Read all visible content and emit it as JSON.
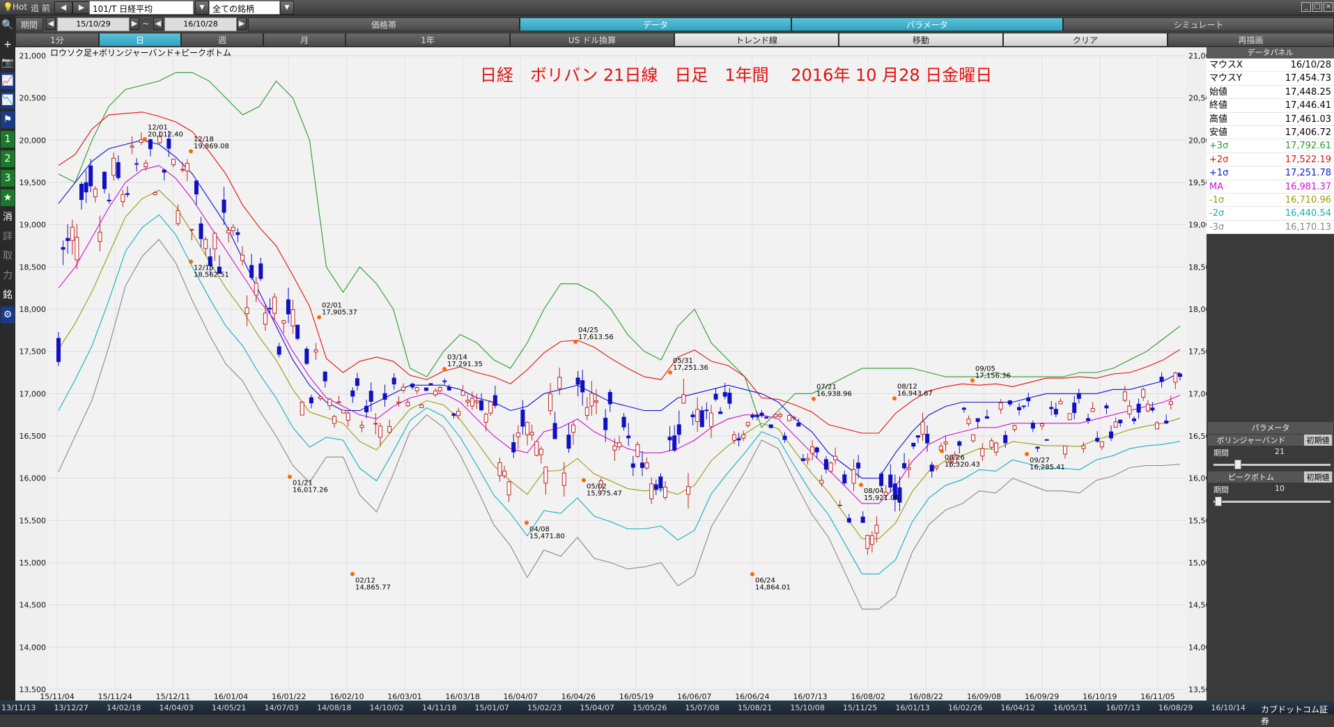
{
  "toolbar": {
    "hot": "Hot",
    "tsui": "追",
    "zen": "前",
    "symbol": "101/T 日経平均",
    "universe": "全ての銘柄",
    "period_label": "期間",
    "date_from": "15/10/29",
    "date_tilde": "~",
    "date_to": "16/10/28",
    "tabs_row1": [
      "価格帯",
      "データ",
      "パラメータ",
      "シミュレート"
    ],
    "tabs_row2": [
      "1分",
      "日",
      "週",
      "月",
      "1年",
      "US ドル換算",
      "トレンド線",
      "移動",
      "クリア",
      "再描画"
    ]
  },
  "left_tools": [
    "🔍",
    "+",
    "📷",
    "📈",
    "📉",
    "⚑",
    "1",
    "2",
    "3",
    "★",
    "消",
    "詳",
    "取",
    "力",
    "銘",
    "⚙"
  ],
  "chart_data": {
    "type": "candlestick",
    "label_topleft": "ロウソク足+ボリンジャーバンド+ピークボトム",
    "title": "日経　ボリバン 21日線　日足　1年間　 2016年 10 月28  日金曜日",
    "ylim": [
      13500,
      21000
    ],
    "yticks": [
      "21,000",
      "20,500",
      "20,000",
      "19,500",
      "19,000",
      "18,500",
      "18,000",
      "17,500",
      "17,000",
      "16,500",
      "16,000",
      "15,500",
      "15,000",
      "14,500",
      "14,000",
      "13,500"
    ],
    "xticks": [
      "15/11/04",
      "15/11/24",
      "15/12/11",
      "16/01/04",
      "16/01/22",
      "16/02/10",
      "16/03/01",
      "16/03/18",
      "16/04/07",
      "16/04/26",
      "16/05/19",
      "16/06/07",
      "16/06/24",
      "16/07/13",
      "16/08/02",
      "16/08/22",
      "16/09/08",
      "16/09/29",
      "16/10/19",
      "16/11/05"
    ],
    "peaks": [
      {
        "date": "12/01",
        "value": "20,012.40"
      },
      {
        "date": "12/18",
        "value": "19,869.08"
      },
      {
        "date": "12/15",
        "value": "18,562.51"
      },
      {
        "date": "02/01",
        "value": "17,905.37"
      },
      {
        "date": "01/21",
        "value": "16,017.26"
      },
      {
        "date": "02/12",
        "value": "14,865.77"
      },
      {
        "date": "03/14",
        "value": "17,291.35"
      },
      {
        "date": "04/08",
        "value": "15,471.80"
      },
      {
        "date": "04/25",
        "value": "17,613.56"
      },
      {
        "date": "05/02",
        "value": "15,975.47"
      },
      {
        "date": "05/31",
        "value": "17,251.36"
      },
      {
        "date": "06/24",
        "value": "14,864.01"
      },
      {
        "date": "07/21",
        "value": "16,938.96"
      },
      {
        "date": "08/04",
        "value": "15,921.04"
      },
      {
        "date": "08/12",
        "value": "16,943.67"
      },
      {
        "date": "08/26",
        "value": "16,320.43"
      },
      {
        "date": "09/05",
        "value": "17,156.36"
      },
      {
        "date": "09/27",
        "value": "16,285.41"
      }
    ],
    "ma_points": [
      18250,
      18500,
      18850,
      19200,
      19500,
      19650,
      19700,
      19550,
      19300,
      19000,
      18700,
      18400,
      18100,
      17850,
      17500,
      17200,
      16950,
      16850,
      16750,
      16700,
      16850,
      16950,
      17000,
      17000,
      16900,
      16700,
      16500,
      16350,
      16300,
      16550,
      16600,
      16700,
      16550,
      16450,
      16350,
      16300,
      16300,
      16350,
      16450,
      16600,
      16700,
      16750,
      16750,
      16700,
      16500,
      16300,
      16100,
      15900,
      15700,
      15700,
      15900,
      16200,
      16400,
      16500,
      16550,
      16600,
      16600,
      16650,
      16650,
      16650,
      16650,
      16650,
      16700,
      16750,
      16800,
      16850,
      16900,
      16980
    ],
    "sigma1_up": [
      19250,
      19500,
      19750,
      19900,
      19950,
      20000,
      19950,
      19800,
      19600,
      19300,
      19000,
      18600,
      18200,
      17800,
      17400,
      17100,
      16900,
      16800,
      16800,
      16900,
      17000,
      17100,
      17100,
      17100,
      17050,
      16950,
      16900,
      16800,
      16850,
      17000,
      17050,
      17100,
      17000,
      16900,
      16850,
      16800,
      16800,
      16950,
      17000,
      17050,
      17100,
      17050,
      17000,
      16900,
      16700,
      16550,
      16300,
      16150,
      16000,
      16000,
      16300,
      16550,
      16750,
      16850,
      16900,
      16900,
      16900,
      16900,
      16950,
      17000,
      17000,
      17000,
      17000,
      17050,
      17050,
      17100,
      17150,
      17250
    ],
    "sigma3_up": [
      19600,
      19500,
      20000,
      20400,
      20600,
      20650,
      20700,
      20800,
      20800,
      20700,
      20500,
      20300,
      20400,
      20700,
      20500,
      20000,
      18500,
      18200,
      18500,
      18300,
      18000,
      17300,
      17200,
      17500,
      17700,
      17600,
      17400,
      17300,
      17600,
      18000,
      18300,
      18300,
      18200,
      18000,
      17700,
      17500,
      17400,
      17800,
      18000,
      17600,
      17400,
      17200,
      16600,
      16800,
      17000,
      17000,
      17100,
      17200,
      17300,
      17300,
      17300,
      17300,
      17250,
      17200,
      17200,
      17200,
      17250,
      17200,
      17200,
      17200,
      17200,
      17250,
      17250,
      17300,
      17400,
      17500,
      17650,
      17800
    ],
    "legend": [
      {
        "label": "+3σ",
        "color": "#2a9a2a"
      },
      {
        "label": "+2σ",
        "color": "#e01010"
      },
      {
        "label": "+1σ",
        "color": "#1010d0"
      },
      {
        "label": "MA",
        "color": "#d010d0"
      },
      {
        "label": "-1σ",
        "color": "#9a9a10"
      },
      {
        "label": "-2σ",
        "color": "#10b0c0"
      },
      {
        "label": "-3σ",
        "color": "#888888"
      }
    ]
  },
  "data_panel": {
    "title": "データパネル",
    "rows": [
      {
        "k": "マウスX",
        "v": "16/10/28",
        "color": "#000"
      },
      {
        "k": "マウスY",
        "v": "17,454.73",
        "color": "#000"
      },
      {
        "k": "始値",
        "v": "17,448.25",
        "color": "#000"
      },
      {
        "k": "終値",
        "v": "17,446.41",
        "color": "#000"
      },
      {
        "k": "高値",
        "v": "17,461.03",
        "color": "#000"
      },
      {
        "k": "安値",
        "v": "17,406.72",
        "color": "#000"
      },
      {
        "k": "+3σ",
        "v": "17,792.61",
        "color": "#2a9a2a"
      },
      {
        "k": "+2σ",
        "v": "17,522.19",
        "color": "#e01010"
      },
      {
        "k": "+1σ",
        "v": "17,251.78",
        "color": "#1010d0"
      },
      {
        "k": "MA",
        "v": "16,981.37",
        "color": "#d010d0"
      },
      {
        "k": "-1σ",
        "v": "16,710.96",
        "color": "#9a9a10"
      },
      {
        "k": "-2σ",
        "v": "16,440.54",
        "color": "#10b0c0"
      },
      {
        "k": "-3σ",
        "v": "16,170.13",
        "color": "#888888"
      }
    ]
  },
  "params": {
    "title": "パラメータ",
    "bb_label": "ボリンジャーバンド",
    "bb_init": "初期値",
    "bb_period_label": "期間",
    "bb_period": "21",
    "pb_label": "ピークボトム",
    "pb_init": "初期値",
    "pb_period_label": "期間",
    "pb_period": "10"
  },
  "bottom_dates": [
    "13/11/13",
    "13/12/27",
    "14/02/18",
    "14/04/03",
    "14/05/21",
    "14/07/03",
    "14/08/18",
    "14/10/02",
    "14/11/18",
    "15/01/07",
    "15/02/23",
    "15/04/07",
    "15/05/26",
    "15/07/08",
    "15/08/21",
    "15/10/08",
    "15/11/25",
    "16/01/13",
    "16/02/26",
    "16/04/12",
    "16/05/31",
    "16/07/13",
    "16/08/29",
    "16/10/14"
  ],
  "bottom_brand": "カブドットコム証券"
}
